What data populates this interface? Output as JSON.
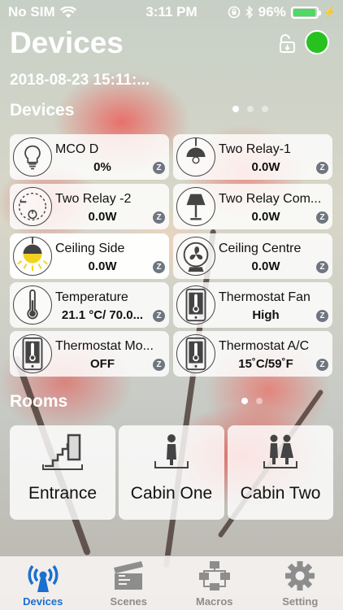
{
  "status_bar": {
    "carrier": "No SIM",
    "time": "3:11 PM",
    "battery": "96%",
    "battery_fraction": 0.96
  },
  "header": {
    "title": "Devices",
    "datetime": "2018-08-23 15:11:..."
  },
  "devices_section": {
    "title": "Devices",
    "page_count": 3,
    "active_page": 0,
    "items": [
      {
        "name": "MCO D",
        "value": "0%",
        "icon": "light-bulb-off-icon"
      },
      {
        "name": "Two Relay-1",
        "value": "0.0W",
        "icon": "ceiling-light-icon"
      },
      {
        "name": "Two Relay -2",
        "value": "0.0W",
        "icon": "dimmer-switch-icon"
      },
      {
        "name": "Two Relay Com...",
        "value": "0.0W",
        "icon": "table-lamp-icon"
      },
      {
        "name": "Ceiling Side",
        "value": "0.0W",
        "icon": "ceiling-light-on-icon"
      },
      {
        "name": "Ceiling Centre",
        "value": "0.0W",
        "icon": "fan-icon"
      },
      {
        "name": "Temperature",
        "value": "21.1 °C/ 70.0...",
        "icon": "thermometer-icon"
      },
      {
        "name": "Thermostat Fan",
        "value": "High",
        "icon": "thermostat-phone-icon"
      },
      {
        "name": "Thermostat Mo...",
        "value": "OFF",
        "icon": "thermostat-phone-icon"
      },
      {
        "name": "Thermostat A/C",
        "value": "15˚C/59˚F",
        "icon": "thermostat-phone-icon"
      }
    ],
    "protocol_badge": "Z"
  },
  "rooms_section": {
    "title": "Rooms",
    "page_count": 2,
    "active_page": 0,
    "items": [
      {
        "name": "Entrance",
        "icon": "stairs-door-icon"
      },
      {
        "name": "Cabin One",
        "icon": "person-icon"
      },
      {
        "name": "Cabin Two",
        "icon": "couple-icon"
      }
    ]
  },
  "tabbar": {
    "tabs": [
      {
        "label": "Devices",
        "icon": "antenna-icon",
        "active": true
      },
      {
        "label": "Scenes",
        "icon": "clapperboard-icon",
        "active": false
      },
      {
        "label": "Macros",
        "icon": "flowchart-icon",
        "active": false
      },
      {
        "label": "Setting",
        "icon": "gear-icon",
        "active": false
      }
    ]
  },
  "colors": {
    "connected": "#27c21f",
    "active_tab": "#1a6fd1",
    "inactive_tab": "#8d8d8d",
    "battery": "#4cd964"
  }
}
